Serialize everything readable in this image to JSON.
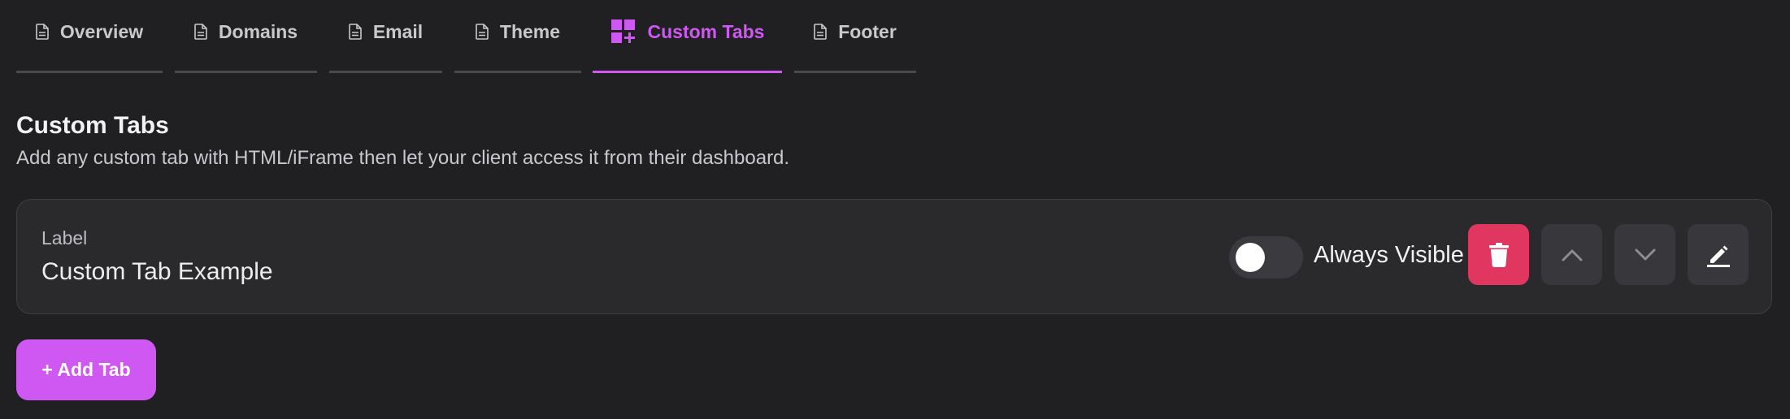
{
  "tabs": [
    {
      "label": "Overview",
      "icon": "document-icon",
      "active": false
    },
    {
      "label": "Domains",
      "icon": "document-icon",
      "active": false
    },
    {
      "label": "Email",
      "icon": "document-icon",
      "active": false
    },
    {
      "label": "Theme",
      "icon": "document-icon",
      "active": false
    },
    {
      "label": "Custom Tabs",
      "icon": "grid-plus-icon",
      "active": true
    },
    {
      "label": "Footer",
      "icon": "document-icon",
      "active": false
    }
  ],
  "section": {
    "title": "Custom Tabs",
    "description": "Add any custom tab with HTML/iFrame then let your client access it from their dashboard."
  },
  "custom_tab": {
    "field_label": "Label",
    "field_value": "Custom Tab Example",
    "visibility_toggle": {
      "label": "Always Visible",
      "on": false
    },
    "actions": [
      "trash-icon",
      "chevron-up-icon",
      "chevron-down-icon",
      "pencil-icon"
    ]
  },
  "add_button": {
    "label": "+ Add Tab"
  },
  "colors": {
    "accent": "#cf57f2",
    "danger": "#e0365f",
    "background": "#202022",
    "card": "#2a2a2d"
  }
}
